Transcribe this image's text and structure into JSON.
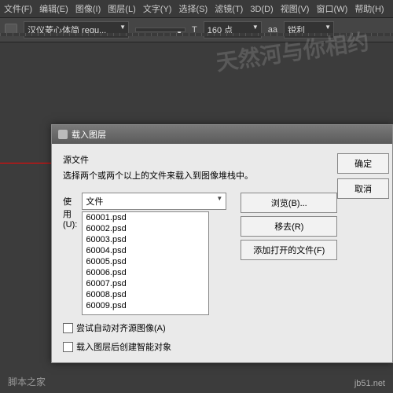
{
  "menu": {
    "file": "文件(F)",
    "edit": "编辑(E)",
    "image": "图像(I)",
    "layer": "图层(L)",
    "type": "文字(Y)",
    "select": "选择(S)",
    "filter": "滤镜(T)",
    "d3": "3D(D)",
    "view": "视图(V)",
    "window": "窗口(W)",
    "help": "帮助(H)"
  },
  "toolbar": {
    "font": "汉仪菱心体简 regu...",
    "size": "160 点",
    "aa_value": "锐利",
    "aa_label": "aa"
  },
  "watermark": "天然河与你相约",
  "dialog": {
    "title": "载入图层",
    "ok": "确定",
    "cancel": "取消",
    "section": "源文件",
    "desc": "选择两个或两个以上的文件来载入到图像堆栈中。",
    "use_label": "使用(U):",
    "use_value": "文件",
    "files": [
      "60001.psd",
      "60002.psd",
      "60003.psd",
      "60004.psd",
      "60005.psd",
      "60006.psd",
      "60007.psd",
      "60008.psd",
      "60009.psd"
    ],
    "browse": "浏览(B)...",
    "remove": "移去(R)",
    "addopen": "添加打开的文件(F)",
    "chk1": "尝试自动对齐源图像(A)",
    "chk2": "载入图层后创建智能对象"
  },
  "footer": {
    "left": "脚本之家",
    "right": "jb51.net"
  }
}
